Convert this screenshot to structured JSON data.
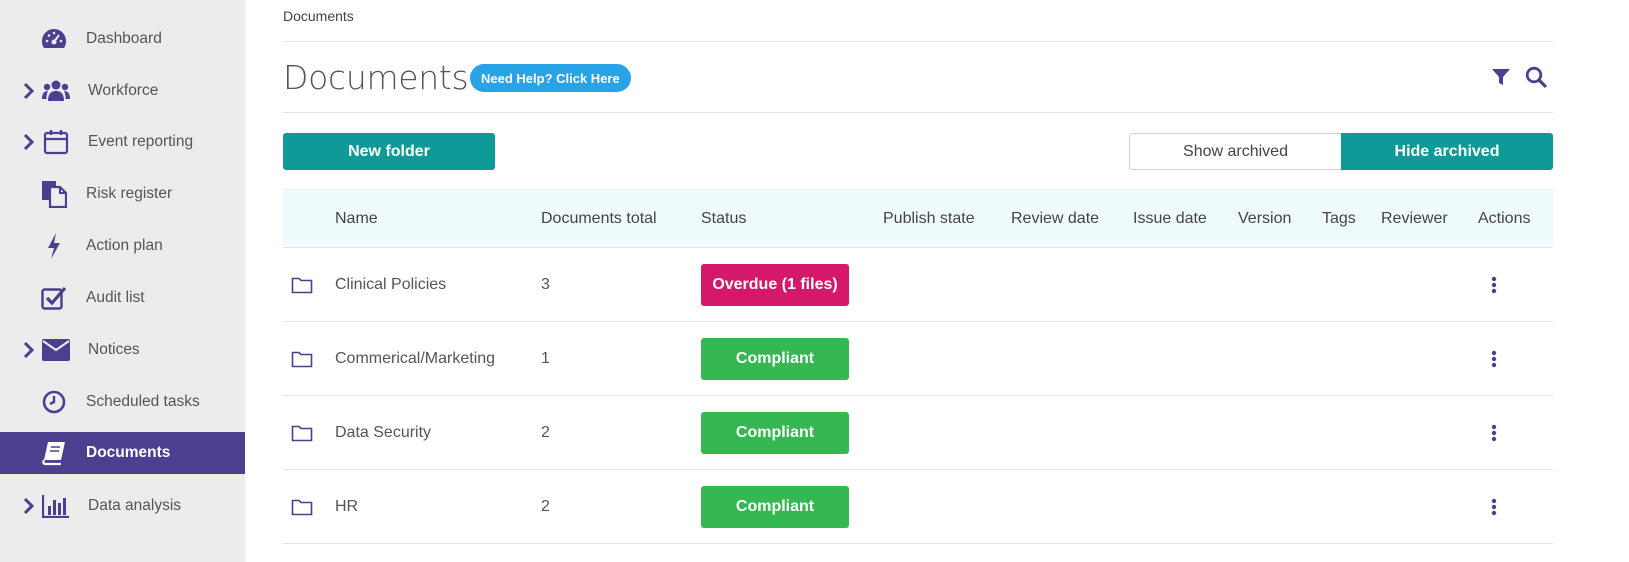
{
  "sidebar": {
    "items": [
      {
        "label": "Dashboard",
        "icon": "dashboard-gauge-icon",
        "has_chevron": false,
        "active": false
      },
      {
        "label": "Workforce",
        "icon": "users-icon",
        "has_chevron": true,
        "active": false
      },
      {
        "label": "Event reporting",
        "icon": "calendar-icon",
        "has_chevron": true,
        "active": false
      },
      {
        "label": "Risk register",
        "icon": "files-icon",
        "has_chevron": false,
        "active": false
      },
      {
        "label": "Action plan",
        "icon": "lightning-icon",
        "has_chevron": false,
        "active": false
      },
      {
        "label": "Audit list",
        "icon": "checkbox-icon",
        "has_chevron": false,
        "active": false
      },
      {
        "label": "Notices",
        "icon": "envelope-icon",
        "has_chevron": true,
        "active": false
      },
      {
        "label": "Scheduled tasks",
        "icon": "clock-icon",
        "has_chevron": false,
        "active": false
      },
      {
        "label": "Documents",
        "icon": "book-icon",
        "has_chevron": false,
        "active": true
      },
      {
        "label": "Data analysis",
        "icon": "bar-chart-icon",
        "has_chevron": true,
        "active": false
      }
    ]
  },
  "breadcrumb": "Documents",
  "page_title": "Documents",
  "help_button": "Need Help? Click Here",
  "toolbar": {
    "new_folder": "New folder",
    "show_archived": "Show archived",
    "hide_archived": "Hide archived",
    "selected_archive_option": "Hide archived"
  },
  "table": {
    "columns": [
      "Name",
      "Documents total",
      "Status",
      "Publish state",
      "Review date",
      "Issue date",
      "Version",
      "Tags",
      "Reviewer",
      "Actions"
    ],
    "rows": [
      {
        "name": "Clinical Policies",
        "total": "3",
        "status": "Overdue (1 files)",
        "status_type": "overdue"
      },
      {
        "name": "Commerical/Marketing",
        "total": "1",
        "status": "Compliant",
        "status_type": "compliant"
      },
      {
        "name": "Data Security",
        "total": "2",
        "status": "Compliant",
        "status_type": "compliant"
      },
      {
        "name": "HR",
        "total": "2",
        "status": "Compliant",
        "status_type": "compliant"
      }
    ]
  },
  "colors": {
    "sidebar_bg": "#ececec",
    "active_bg": "#4b3f8f",
    "icon": "#4b3f8f",
    "teal": "#0f9a97",
    "help_blue": "#29a3e8",
    "overdue": "#d4186a",
    "compliant": "#35b851"
  }
}
